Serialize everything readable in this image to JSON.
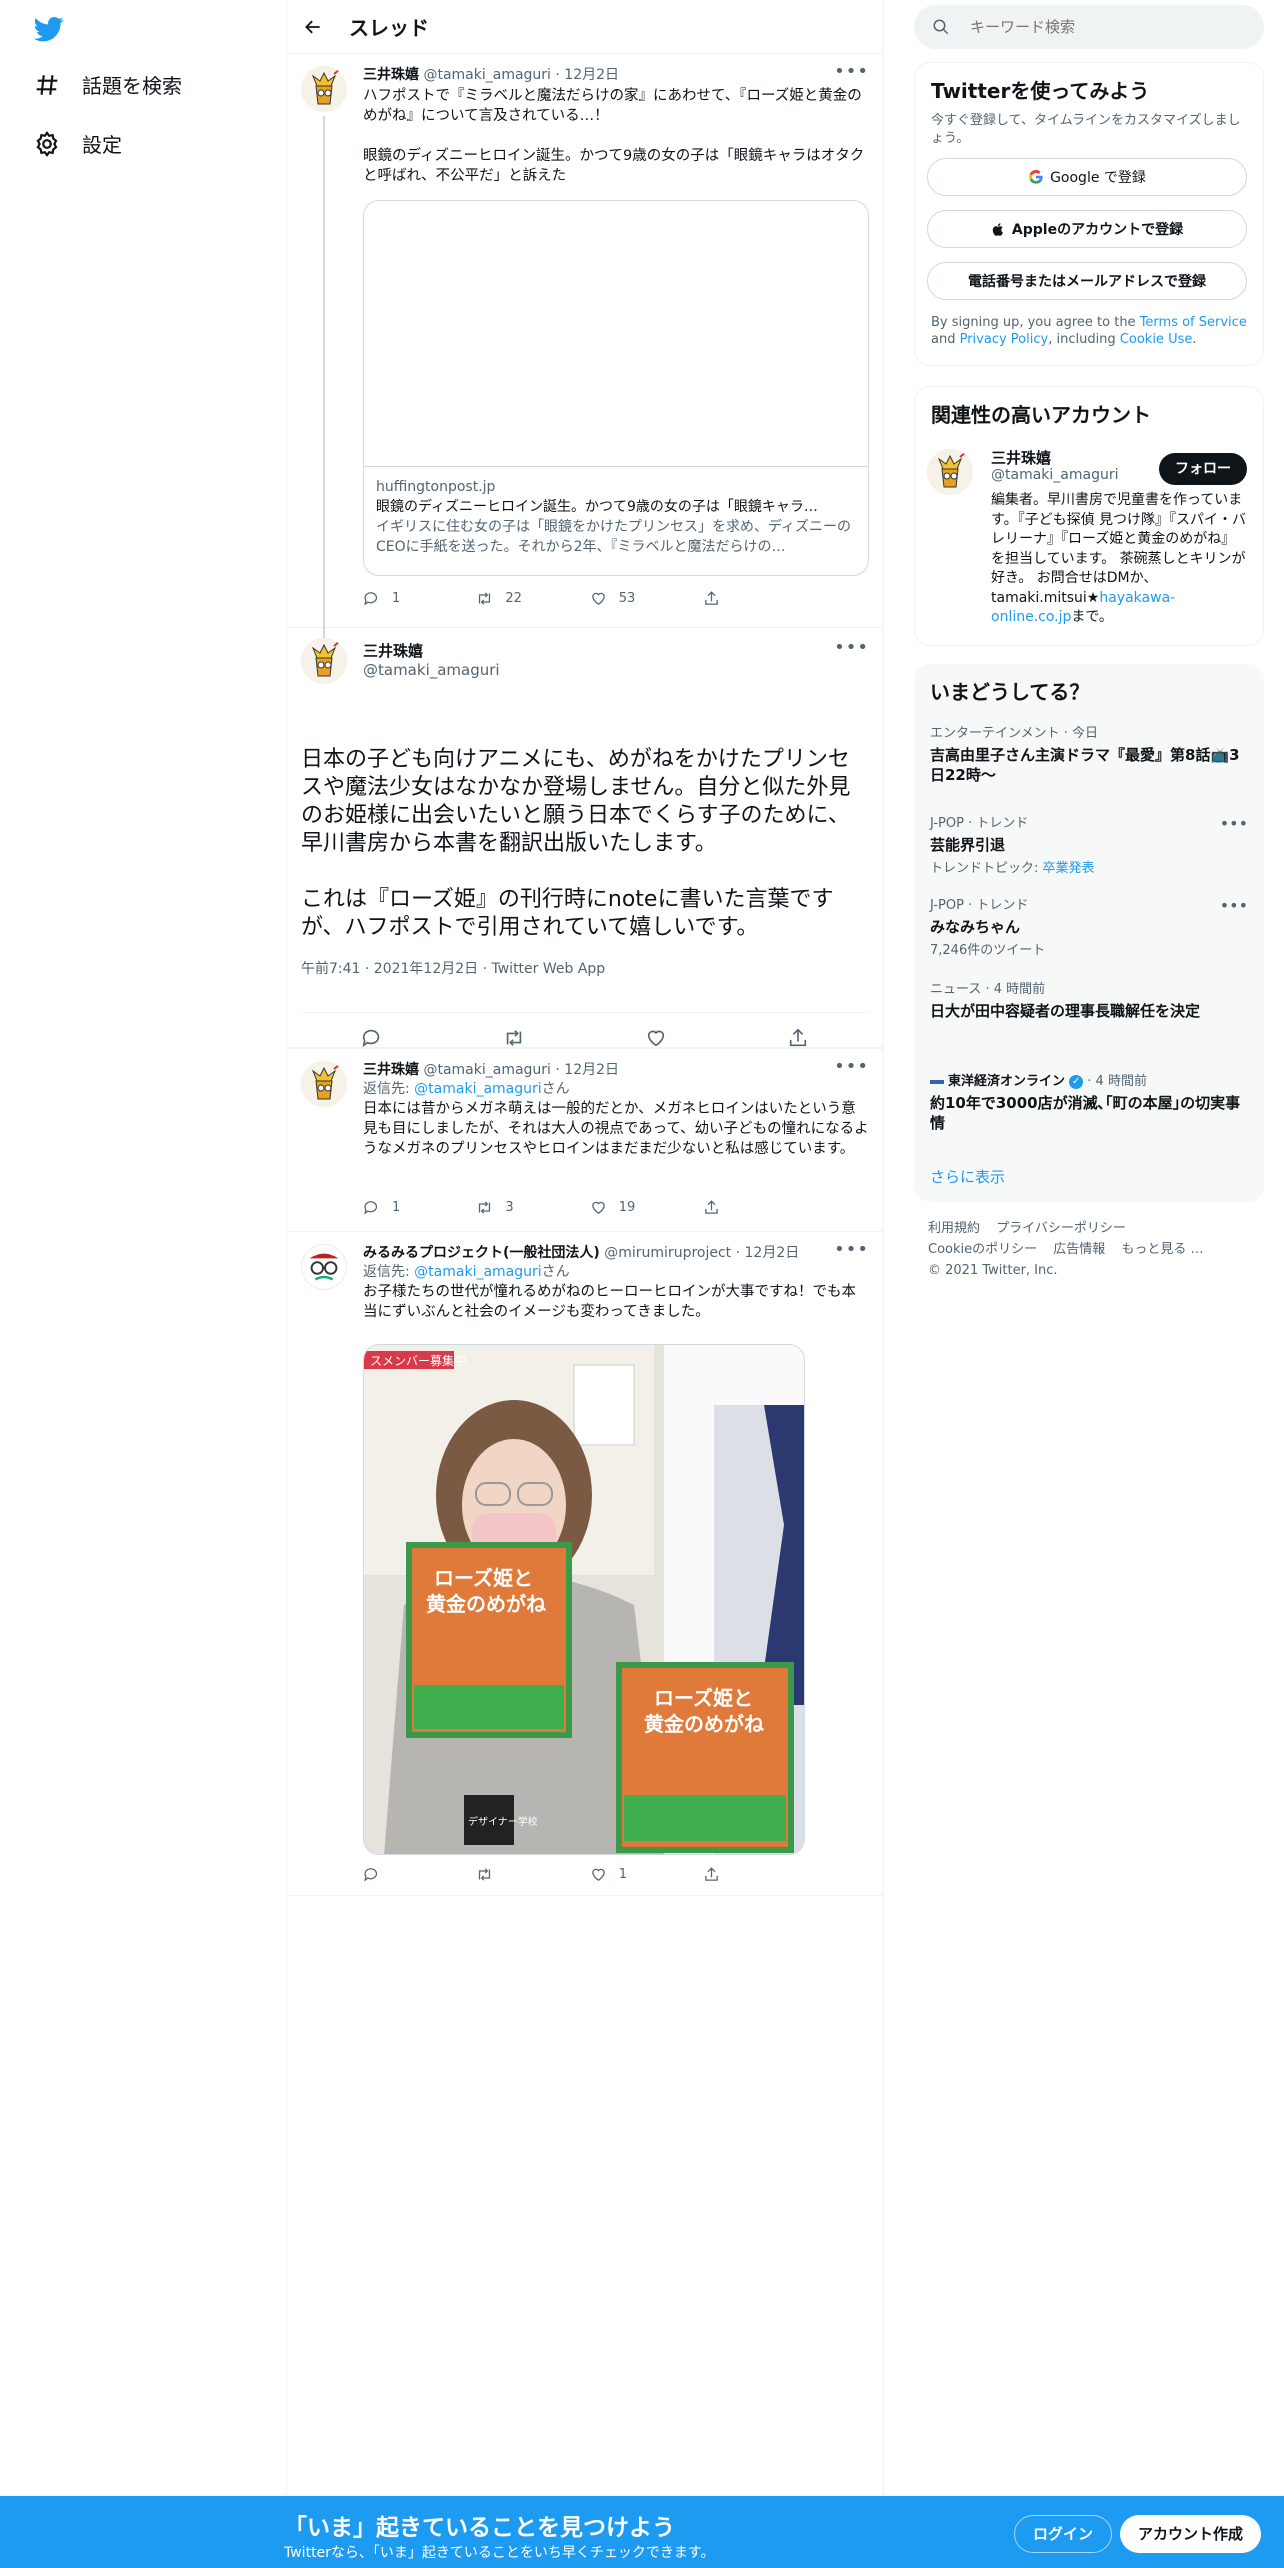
{
  "nav": {
    "explore_label": "話題を検索",
    "settings_label": "設定"
  },
  "header": {
    "title": "スレッド"
  },
  "tweets": {
    "t1": {
      "name": "三井珠嬉",
      "handle": "@tamaki_amaguri",
      "date": "12月2日",
      "text": "ハフポストで『ミラベルと魔法だらけの家』にあわせて、『ローズ姫と黄金のめがね』について言及されている…！\n\n眼鏡のディズニーヒロイン誕生。かつて9歳の女の子は「眼鏡キャラはオタクと呼ばれ、不公平だ」と訴えた",
      "card": {
        "domain": "huffingtonpost.jp",
        "title": "眼鏡のディズニーヒロイン誕生。かつて9歳の女の子は「眼鏡キャラ…",
        "desc": "イギリスに住む女の子は「眼鏡をかけたプリンセス」を求め、ディズニーのCEOに手紙を送った。それから2年、『ミラベルと魔法だらけの…"
      },
      "replies": "1",
      "retweets": "22",
      "likes": "53"
    },
    "focus": {
      "name": "三井珠嬉",
      "handle": "@tamaki_amaguri",
      "text": "日本の子ども向けアニメにも、めがねをかけたプリンセスや魔法少女はなかなか登場しません。自分と似た外見のお姫様に出会いたいと願う日本でくらす子のために、早川書房から本書を翻訳出版いたします。\n\nこれは『ローズ姫』の刊行時にnoteに書いた言葉ですが、ハフポストで引用されていて嬉しいです。",
      "meta": "午前7:41 · 2021年12月2日 · Twitter Web App"
    },
    "t3": {
      "name": "三井珠嬉",
      "handle": "@tamaki_amaguri",
      "date": "12月2日",
      "reply_prefix": "返信先: ",
      "reply_to": "@tamaki_amaguri",
      "reply_suffix": "さん",
      "text": "日本には昔からメガネ萌えは一般的だとか、メガネヒロインはいたという意見も目にしましたが、それは大人の視点であって、幼い子どもの憧れになるようなメガネのプリンセスやヒロインはまだまだ少ないと私は感じています。",
      "replies": "1",
      "retweets": "3",
      "likes": "19"
    },
    "t4": {
      "name": "みるみるプロジェクト(一般社団法人)",
      "handle": "@mirumiruproject",
      "date": "12月2日",
      "reply_prefix": "返信先: ",
      "reply_to": "@tamaki_amaguri",
      "reply_suffix": "さん",
      "text": "お子様たちの世代が憧れるめがねのヒーローヒロインが大事ですね！でも本当にずいぶんと社会のイメージも変わってきました。",
      "photo": {
        "banner": "スメンバー募集中",
        "book_title_1": "ローズ姫と",
        "book_title_2": "黄金のめがね",
        "badge": "デザイナー学校"
      },
      "likes": "1"
    }
  },
  "sidebar": {
    "search_placeholder": "キーワード検索",
    "signup": {
      "title": "Twitterを使ってみよう",
      "sub": "今すぐ登録して、タイムラインをカスタマイズしましょう。",
      "google": "Google で登録",
      "apple": "Appleのアカウントで登録",
      "phone": "電話番号またはメールアドレスで登録",
      "legal_1": "By signing up, you agree to the ",
      "tos": "Terms of Service",
      "legal_2": " and ",
      "privacy": "Privacy Policy",
      "legal_3": ", including ",
      "cookie": "Cookie Use",
      "legal_4": "."
    },
    "related": {
      "title": "関連性の高いアカウント",
      "name": "三井珠嬉",
      "handle": "@tamaki_amaguri",
      "follow": "フォロー",
      "bio": "編集者。早川書房で児童書を作っています。『子ども探偵 見つけ隊』『スパイ・バレリーナ』『ローズ姫と黄金のめがね』を担当しています。 茶碗蒸しとキリンが好き。 お問合せはDMか、tamaki.mitsui★",
      "bio_link": "hayakawa-online.co.jp",
      "bio_end": "まで。"
    },
    "trends": {
      "title": "いまどうしてる？",
      "items": [
        {
          "cat": "エンターテインメント · 今日",
          "title": "吉高由里子さん主演ドラマ『最愛』第8話📺3日22時〜"
        },
        {
          "cat": "J-POP · トレンド",
          "title": "芸能界引退",
          "sub_prefix": "トレンドトピック: ",
          "sub_link": "卒業発表"
        },
        {
          "cat": "J-POP · トレンド",
          "title": "みなみちゃん",
          "sub": "7,246件のツイート"
        },
        {
          "cat": "ニュース · 4 時間前",
          "title": "日大が田中容疑者の理事長職解任を決定"
        },
        {
          "cat_source": "東洋経済オンライン",
          "cat_time": " · 4 時間前",
          "title": "約10年で3000店が消滅､｢町の本屋｣の切実事情"
        }
      ],
      "more": "さらに表示"
    },
    "footer": {
      "links": [
        "利用規約",
        "プライバシーポリシー",
        "Cookieのポリシー",
        "広告情報",
        "もっと見る …"
      ],
      "copyright": "© 2021 Twitter, Inc."
    }
  },
  "bottom": {
    "title": "「いま」起きていることを見つけよう",
    "sub": "Twitterなら、「いま」起きていることをいち早くチェックできます。",
    "login": "ログイン",
    "signup": "アカウント作成"
  },
  "colors": {
    "accent": "#1d9bf0",
    "text": "#0f1419",
    "muted": "#536471"
  }
}
